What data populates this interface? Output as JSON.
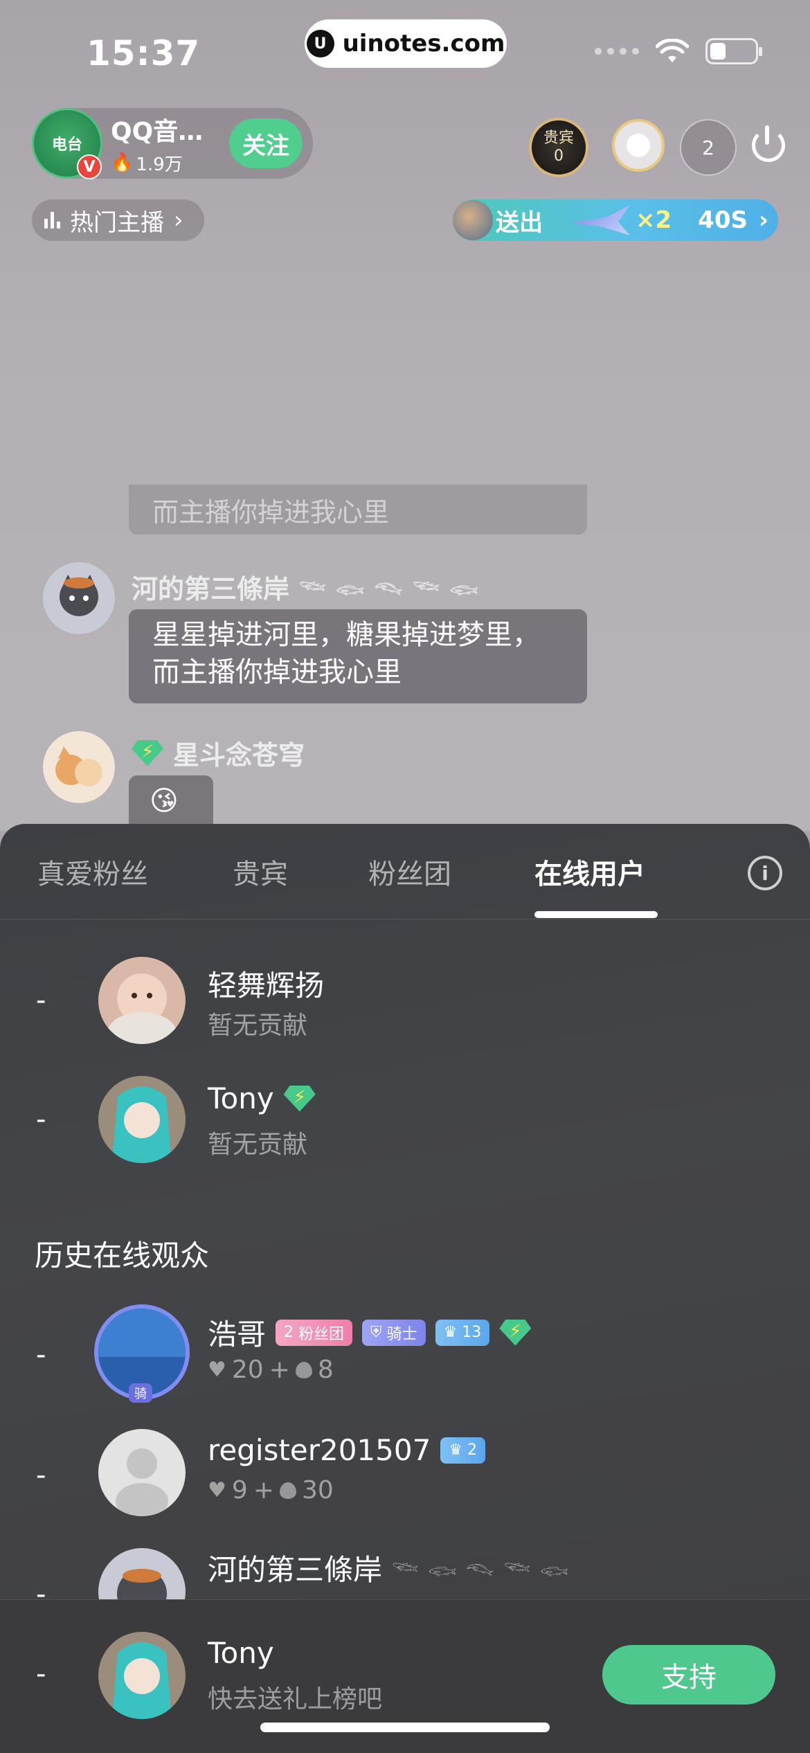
{
  "status_bar": {
    "time": "15:37",
    "watermark": "uinotes.com"
  },
  "host": {
    "avatar_text": "电台",
    "name": "QQ音…",
    "fans": "1.9万",
    "follow_label": "关注"
  },
  "top_right": {
    "vip_label": "贵宾",
    "vip_count": "0",
    "online_count": "2"
  },
  "hot_host_label": "热门主播",
  "gift_banner": {
    "sent_label": "送出",
    "multiplier": "×2",
    "countdown": "40S"
  },
  "chat": {
    "prev_text": "而主播你掉进我心里",
    "messages": [
      {
        "user": "河的第三條岸",
        "text_line1": "星星掉进河里，糖果掉进梦里，",
        "text_line2": "而主播你掉进我心里"
      },
      {
        "user": "星斗念苍穹",
        "text": "😘"
      }
    ]
  },
  "panel": {
    "tabs": [
      "真爱粉丝",
      "贵宾",
      "粉丝团",
      "在线用户"
    ],
    "active_tab": "在线用户",
    "online_users": [
      {
        "rank": "-",
        "name": "轻舞辉扬",
        "sub": "暂无贡献"
      },
      {
        "rank": "-",
        "name": "Tony",
        "sub": "暂无贡献"
      }
    ],
    "history_title": "历史在线观众",
    "history_users": [
      {
        "rank": "-",
        "name": "浩哥",
        "fan_level": "2",
        "fan_tag": "粉丝团",
        "knight_tag": "骑士",
        "crown_level": "13",
        "hearts": "20",
        "plus": "+",
        "drops": "8",
        "avatar_badge": "骑"
      },
      {
        "rank": "-",
        "name": "register201507",
        "crown_level": "2",
        "hearts": "9",
        "plus": "+",
        "drops": "30"
      },
      {
        "rank": "-",
        "name": "河的第三條岸"
      }
    ],
    "footer": {
      "rank": "-",
      "name": "Tony",
      "sub": "快去送礼上榜吧",
      "support_label": "支持"
    }
  }
}
